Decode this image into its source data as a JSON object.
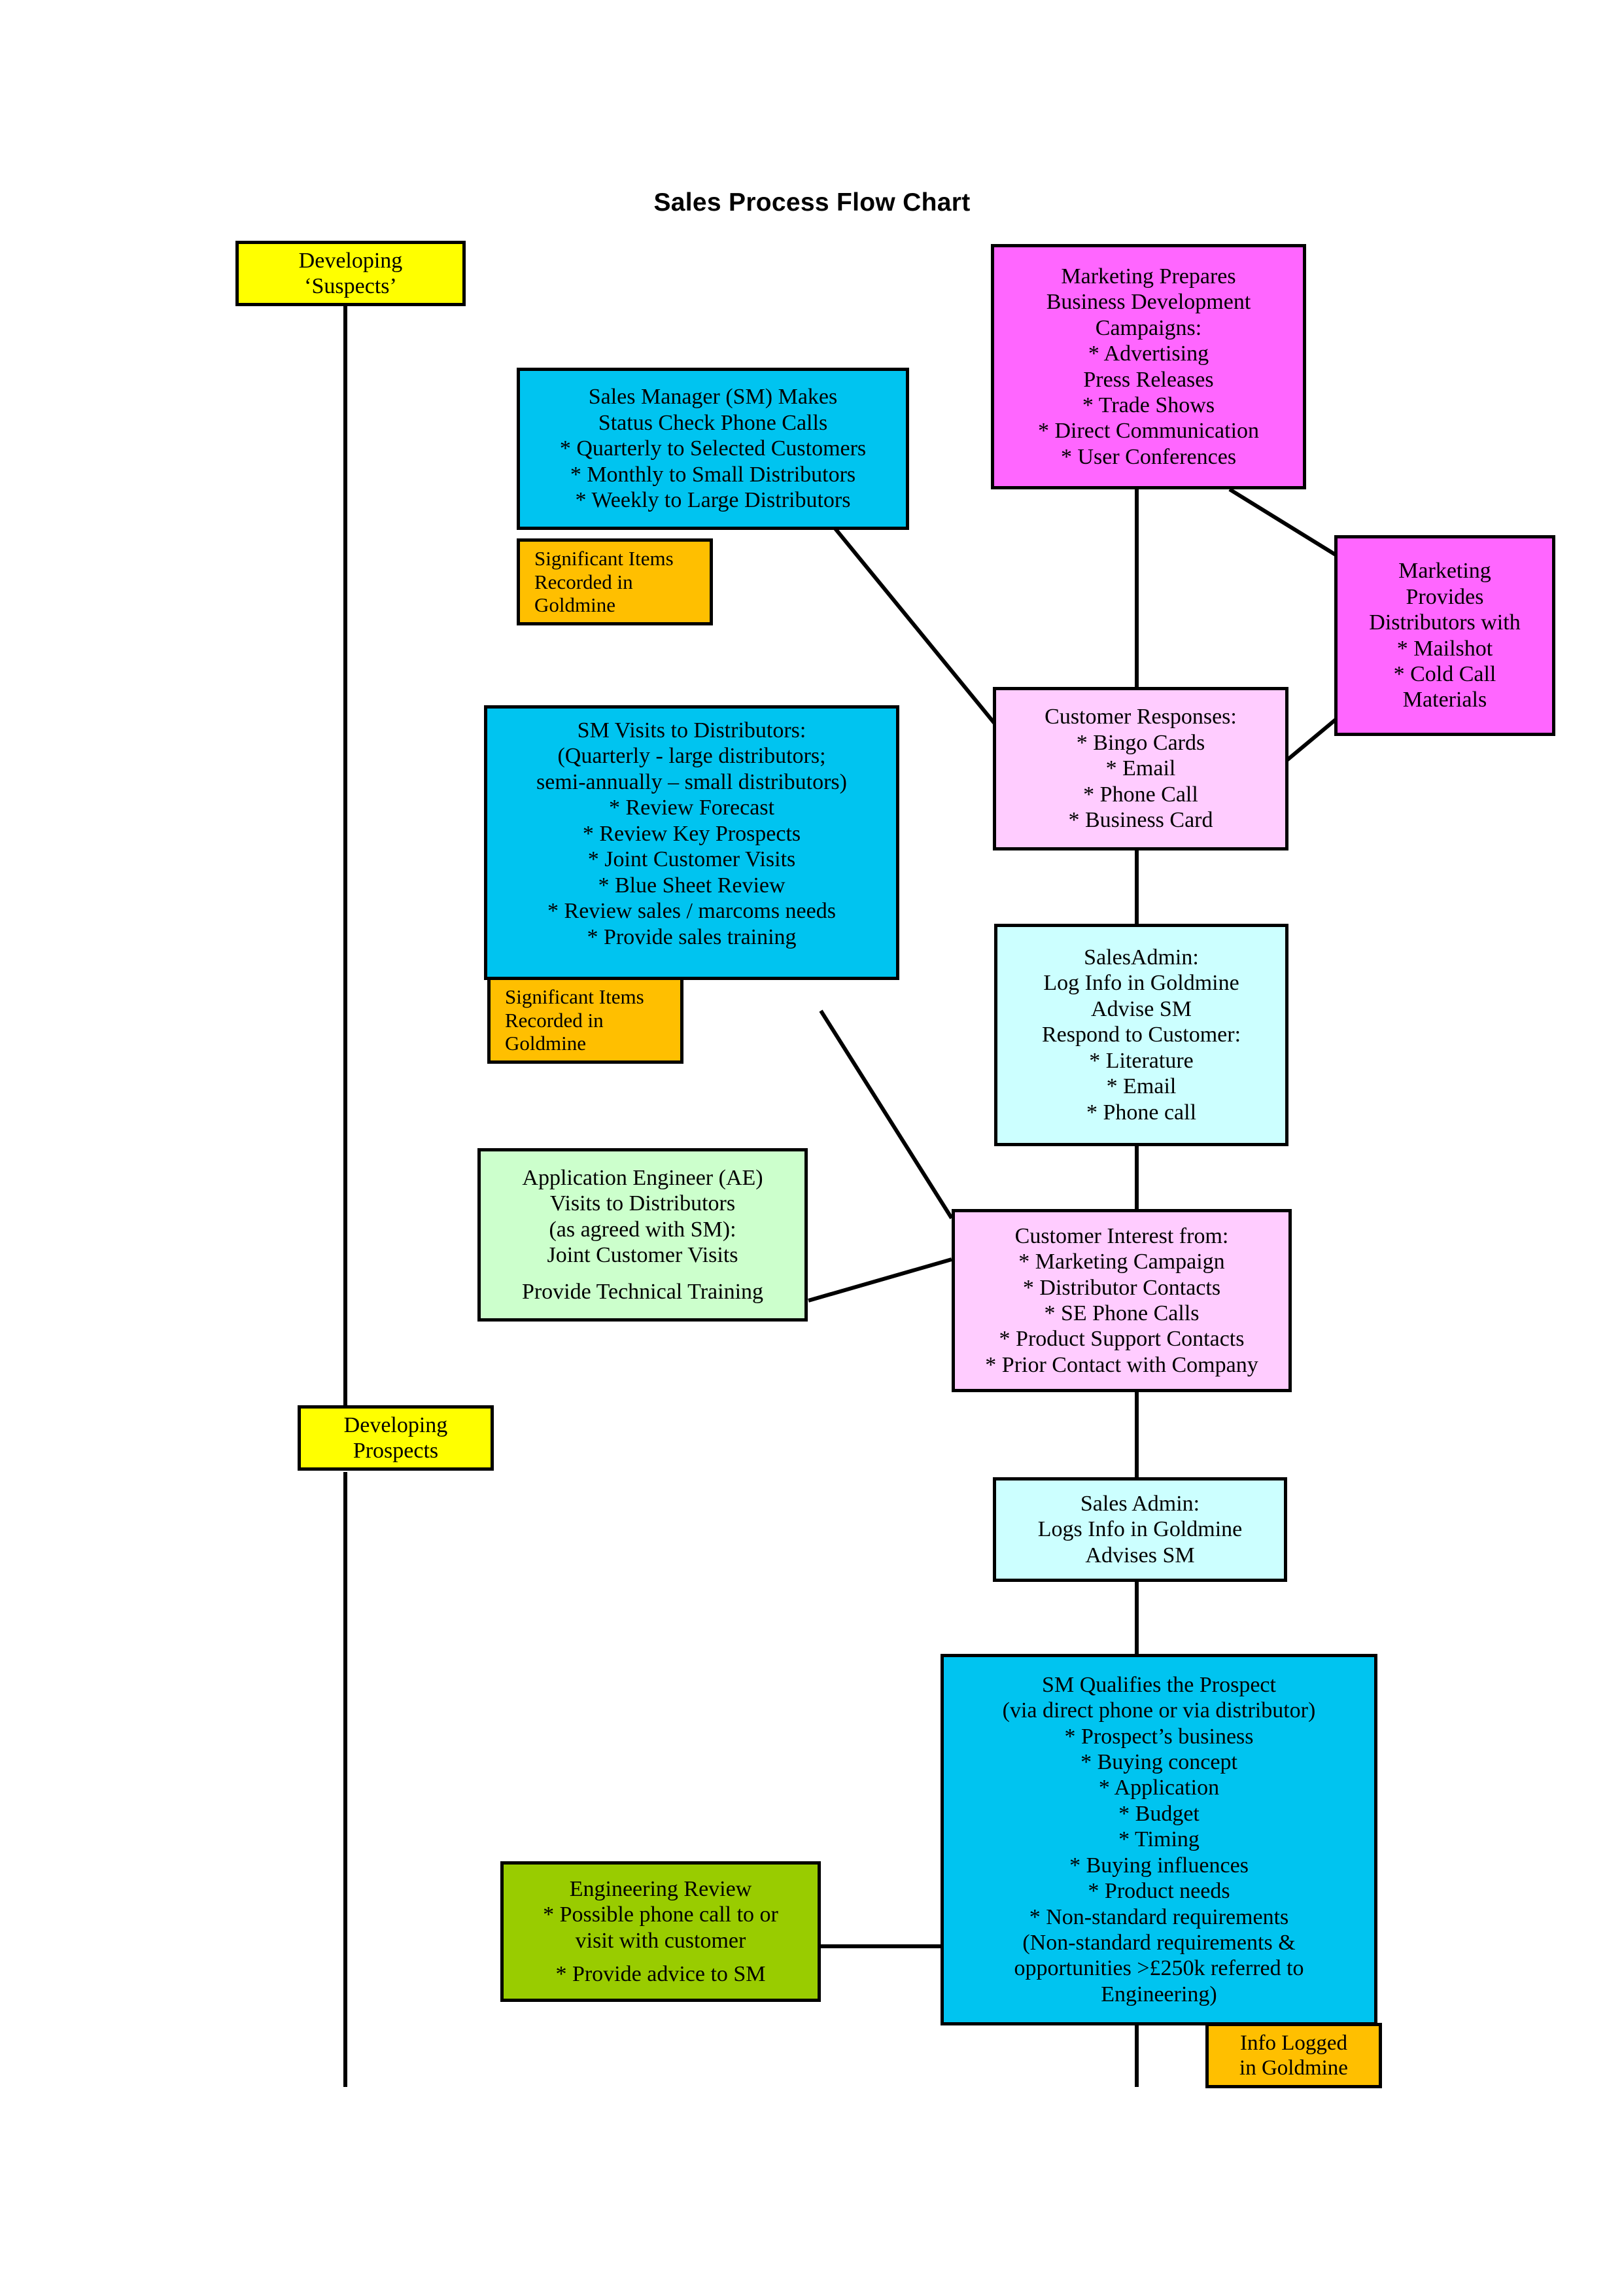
{
  "title": "Sales Process Flow Chart",
  "colors": {
    "yellow": "#FFFF00",
    "magenta": "#FF66FF",
    "cyan": "#00C4F0",
    "orange": "#FFBF00",
    "pink": "#FFCCFF",
    "light_cyan": "#CCFFFF",
    "light_green": "#CCFFCC",
    "olive_green": "#99CC00",
    "line": "#000000",
    "border": "#000000"
  },
  "nodes": {
    "developing_suspects": {
      "name": "Developing Suspects",
      "color": "yellow",
      "lines": [
        "Developing",
        "‘Suspects’"
      ]
    },
    "marketing_prepares": {
      "name": "Marketing Prepares Business Development Campaigns",
      "color": "magenta",
      "lines": [
        "Marketing Prepares",
        "Business Development",
        "Campaigns:",
        "* Advertising",
        "Press Releases",
        "* Trade Shows",
        "* Direct Communication",
        "* User Conferences"
      ]
    },
    "sm_status_calls": {
      "name": "Sales Manager Makes Status Check Phone Calls",
      "color": "cyan",
      "lines": [
        "Sales Manager (SM) Makes",
        "Status Check Phone Calls",
        "* Quarterly to Selected Customers",
        "* Monthly to Small Distributors",
        "* Weekly to Large Distributors"
      ]
    },
    "significant_items_1": {
      "name": "Significant Items Recorded in Goldmine",
      "color": "orange",
      "lines": [
        "Significant Items",
        "Recorded in",
        "Goldmine"
      ]
    },
    "marketing_provides": {
      "name": "Marketing Provides Distributors with Materials",
      "color": "magenta",
      "lines": [
        "Marketing",
        "Provides",
        "Distributors with",
        "* Mailshot",
        "* Cold Call",
        "Materials"
      ]
    },
    "customer_responses": {
      "name": "Customer Responses",
      "color": "pink",
      "lines": [
        "Customer Responses:",
        "* Bingo Cards",
        "* Email",
        "* Phone Call",
        "* Business Card"
      ]
    },
    "sm_visits": {
      "name": "SM Visits to Distributors",
      "color": "cyan",
      "lines": [
        "SM Visits to Distributors:",
        "(Quarterly - large distributors;",
        "semi-annually – small distributors)",
        "* Review Forecast",
        "* Review Key Prospects",
        "* Joint Customer Visits",
        "* Blue Sheet Review",
        "* Review sales / marcoms needs",
        "* Provide sales training"
      ]
    },
    "significant_items_2": {
      "name": "Significant Items Recorded in Goldmine",
      "color": "orange",
      "lines": [
        "Significant Items",
        "Recorded in",
        "Goldmine"
      ]
    },
    "salesadmin_respond": {
      "name": "SalesAdmin Log Info and Respond to Customer",
      "color": "light_cyan",
      "lines": [
        "SalesAdmin:",
        "Log Info in Goldmine",
        "Advise SM",
        "Respond to Customer:",
        "* Literature",
        "* Email",
        "* Phone call"
      ]
    },
    "application_engineer": {
      "name": "Application Engineer Visits to Distributors",
      "color": "light_green",
      "lines": [
        "Application Engineer (AE)",
        "Visits to Distributors",
        "(as agreed with SM):",
        "Joint Customer Visits",
        "Provide Technical Training"
      ]
    },
    "customer_interest": {
      "name": "Customer Interest from",
      "color": "pink",
      "lines": [
        "Customer Interest from:",
        "* Marketing Campaign",
        "* Distributor Contacts",
        "* SE Phone Calls",
        "* Product Support Contacts",
        "* Prior Contact with Company"
      ]
    },
    "developing_prospects": {
      "name": "Developing Prospects",
      "color": "yellow",
      "lines": [
        "Developing",
        "Prospects"
      ]
    },
    "sales_admin_logs": {
      "name": "Sales Admin Logs Info in Goldmine",
      "color": "light_cyan",
      "lines": [
        "Sales Admin:",
        "Logs Info in Goldmine",
        "Advises SM"
      ]
    },
    "sm_qualifies": {
      "name": "SM Qualifies the Prospect",
      "color": "cyan",
      "lines": [
        "SM Qualifies the Prospect",
        "(via direct phone or via distributor)",
        "* Prospect’s business",
        "* Buying concept",
        "* Application",
        "* Budget",
        "* Timing",
        "* Buying influences",
        "* Product needs",
        "* Non-standard requirements",
        "(Non-standard requirements &",
        "opportunities >£250k referred to",
        "Engineering)"
      ]
    },
    "engineering_review": {
      "name": "Engineering Review",
      "color": "olive_green",
      "lines": [
        "Engineering Review",
        "* Possible phone call to or",
        "visit with customer",
        "* Provide advice to SM"
      ]
    },
    "info_logged": {
      "name": "Info Logged in Goldmine",
      "color": "orange",
      "lines": [
        "Info Logged",
        "in Goldmine"
      ]
    }
  }
}
